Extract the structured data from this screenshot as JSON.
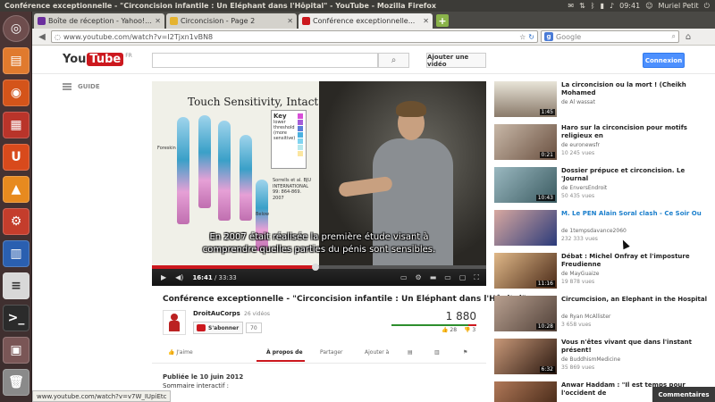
{
  "panel": {
    "window_title": "Conférence exceptionnelle - \"Circoncision infantile : Un Eléphant dans l'Hôpital\" - YouTube - Mozilla Firefox",
    "time": "09:41",
    "user": "Muriel Petit"
  },
  "browser": {
    "tabs": [
      {
        "label": "Boîte de réception - Yahoo!...",
        "favicon_color": "#6b2e9e"
      },
      {
        "label": "Circoncision - Page 2",
        "favicon_color": "#e5b330"
      },
      {
        "label": "Conférence exceptionnelle...",
        "favicon_color": "#cc181e"
      }
    ],
    "url": "www.youtube.com/watch?v=I2Tjxn1vBN8",
    "search_placeholder": "Google"
  },
  "youtube": {
    "logo_you": "You",
    "logo_tube": "Tube",
    "logo_locale": "FR",
    "upload_label": "Ajouter une vidéo",
    "connect_label": "Connexion",
    "guide_label": "GUIDE",
    "player": {
      "slide_title": "Touch Sensitivity, Intact",
      "key_title": "Key",
      "key_lines": [
        "lower",
        "threshold",
        "(more",
        "sensitive)"
      ],
      "reference": "Sorrells et al. BJU INTERNATIONAL 99: 864-869. 2007",
      "slide_labels": [
        "Foreskin",
        "Below"
      ],
      "subtitle_line1": "En 2007 était réalisée la première étude visant à",
      "subtitle_line2": "comprendre quelles parties du pénis sont sensibles.",
      "current_time": "16:41",
      "total_time": "33:33",
      "progress": 0.49
    },
    "video": {
      "title": "Conférence exceptionnelle - \"Circoncision infantile : Un Eléphant dans l'Hôpital\"",
      "channel": "DroitAuCorps",
      "channel_videos": "26 vidéos",
      "subscribe_label": "S'abonner",
      "subscriber_count": "70",
      "views": "1 880",
      "likes": "28",
      "dislikes": "3",
      "like_fraction": 0.9
    },
    "actions": {
      "like": "J'aime",
      "about": "À propos de",
      "share": "Partager",
      "add_to": "Ajouter à"
    },
    "published": "Publiée le 10 juin 2012",
    "summary": "Sommaire interactif :",
    "comments_label": "Commentaires",
    "suggestions": [
      {
        "title": "La circoncision ou la mort ! (Cheikh Mohamed",
        "by": "de Al wassat",
        "views": "",
        "duration": "1:45"
      },
      {
        "title": "Haro sur la circoncision pour motifs religieux en",
        "by": "de euronewsfr",
        "views": "10 245 vues",
        "duration": "0:21"
      },
      {
        "title": "Dossier prépuce et circoncision. Le 'Journal",
        "by": "de EnversEndroit",
        "views": "50 435 vues",
        "duration": "10:43"
      },
      {
        "title": "M. Le PEN Alain Soral clash - Ce Soir Ou",
        "by": "de 1tempsdavance2060",
        "views": "232 333 vues",
        "duration": ""
      },
      {
        "title": "Débat : Michel Onfray et l'imposture Freudienne",
        "by": "de MayGuaize",
        "views": "19 878 vues",
        "duration": "11:16"
      },
      {
        "title": "Circumcision, an Elephant in the Hospital",
        "by": "de Ryan McAllister",
        "views": "3 658 vues",
        "duration": "10:28"
      },
      {
        "title": "Vous n'êtes vivant que dans l'instant présent!",
        "by": "de BuddhismMedicine",
        "views": "35 869 vues",
        "duration": "6:32"
      },
      {
        "title": "Anwar Haddam : \"Il est temps pour l'occident de",
        "by": "",
        "views": "",
        "duration": ""
      }
    ]
  },
  "status_url": "www.youtube.com/watch?v=v7W_IUpiEtc",
  "colors": {
    "youtube_red": "#cc181e",
    "connect_blue": "#4d90fe",
    "panel": "#3c3b37"
  }
}
